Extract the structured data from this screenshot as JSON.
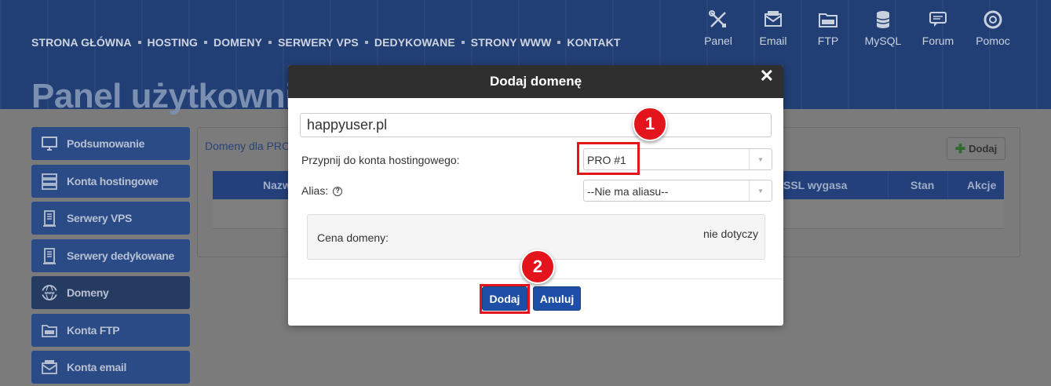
{
  "nav": {
    "items": [
      "STRONA GŁÓWNA",
      "HOSTING",
      "DOMENY",
      "SERWERY VPS",
      "DEDYKOWANE",
      "STRONY WWW",
      "KONTAKT"
    ]
  },
  "top_icons": [
    {
      "label": "Panel",
      "icon": "tools-icon"
    },
    {
      "label": "Email",
      "icon": "email-icon"
    },
    {
      "label": "FTP",
      "icon": "ftp-folder-icon"
    },
    {
      "label": "MySQL",
      "icon": "database-icon"
    },
    {
      "label": "Forum",
      "icon": "forum-icon"
    },
    {
      "label": "Pomoc",
      "icon": "lifebuoy-icon"
    }
  ],
  "page": {
    "title": "Panel użytkowni"
  },
  "sidebar": {
    "items": [
      {
        "label": "Podsumowanie",
        "icon": "monitor-icon"
      },
      {
        "label": "Konta hostingowe",
        "icon": "server-icon"
      },
      {
        "label": "Serwery VPS",
        "icon": "tower-icon"
      },
      {
        "label": "Serwery dedykowane",
        "icon": "tower-icon"
      },
      {
        "label": "Domeny",
        "icon": "globe-www-icon",
        "active": true
      },
      {
        "label": "Konta FTP",
        "icon": "ftp-folder-icon"
      },
      {
        "label": "Konta email",
        "icon": "email-icon"
      }
    ]
  },
  "content": {
    "heading": "Domeny dla PRO",
    "add_label": "Dodaj",
    "columns": [
      "Nazw",
      "SSL wygasa",
      "Stan",
      "Akcje"
    ]
  },
  "modal": {
    "title": "Dodaj domenę",
    "close": "✕",
    "domain_value": "happyuser.pl",
    "hosting_label": "Przypnij do konta hostingowego:",
    "hosting_selected": "PRO #1",
    "alias_label": "Alias:",
    "alias_help": "?",
    "alias_selected": "--Nie ma aliasu--",
    "price_label": "Cena domeny:",
    "price_value": "nie dotyczy",
    "submit_label": "Dodaj",
    "cancel_label": "Anuluj"
  },
  "annotations": {
    "badge1": "1",
    "badge2": "2",
    "color": "#e3141c"
  },
  "colors": {
    "brand": "#223f75",
    "button": "#1e4fa6",
    "modal_header": "#2f2f2f"
  }
}
